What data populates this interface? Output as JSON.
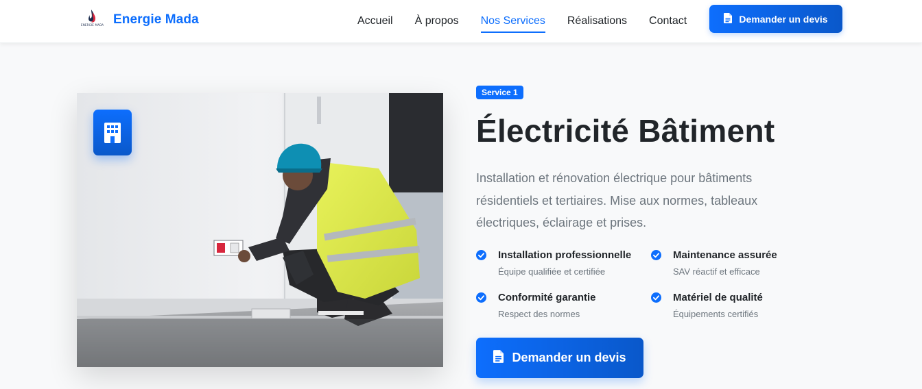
{
  "nav": {
    "brand_name": "Energie Mada",
    "logo_text": "ENERGIE MADA",
    "links": [
      "Accueil",
      "À propos",
      "Nos Services",
      "Réalisations",
      "Contact"
    ],
    "active_link": "Nos Services",
    "cta_label": "Demander un devis",
    "cta_icon": "file-document-icon"
  },
  "service": {
    "badge": "Service 1",
    "title": "Électricité Bâtiment",
    "description": "Installation et rénovation électrique pour bâtiments résidentiels et tertiaires. Mise aux normes, tableaux électriques, éclairage et prises.",
    "image_icon": "building-icon",
    "features": [
      {
        "title": "Installation professionnelle",
        "subtitle": "Équipe qualifiée et certifiée",
        "icon": "check-circle-icon"
      },
      {
        "title": "Maintenance assurée",
        "subtitle": "SAV réactif et efficace",
        "icon": "check-circle-icon"
      },
      {
        "title": "Conformité garantie",
        "subtitle": "Respect des normes",
        "icon": "check-circle-icon"
      },
      {
        "title": "Matériel de qualité",
        "subtitle": "Équipements certifiés",
        "icon": "check-circle-icon"
      }
    ],
    "cta_label": "Demander un devis",
    "cta_icon": "file-document-icon"
  },
  "colors": {
    "primary": "#0d6efd",
    "primary_dark": "#0a58ca",
    "text": "#212529",
    "muted": "#6c757d",
    "background": "#f8f9fa"
  }
}
